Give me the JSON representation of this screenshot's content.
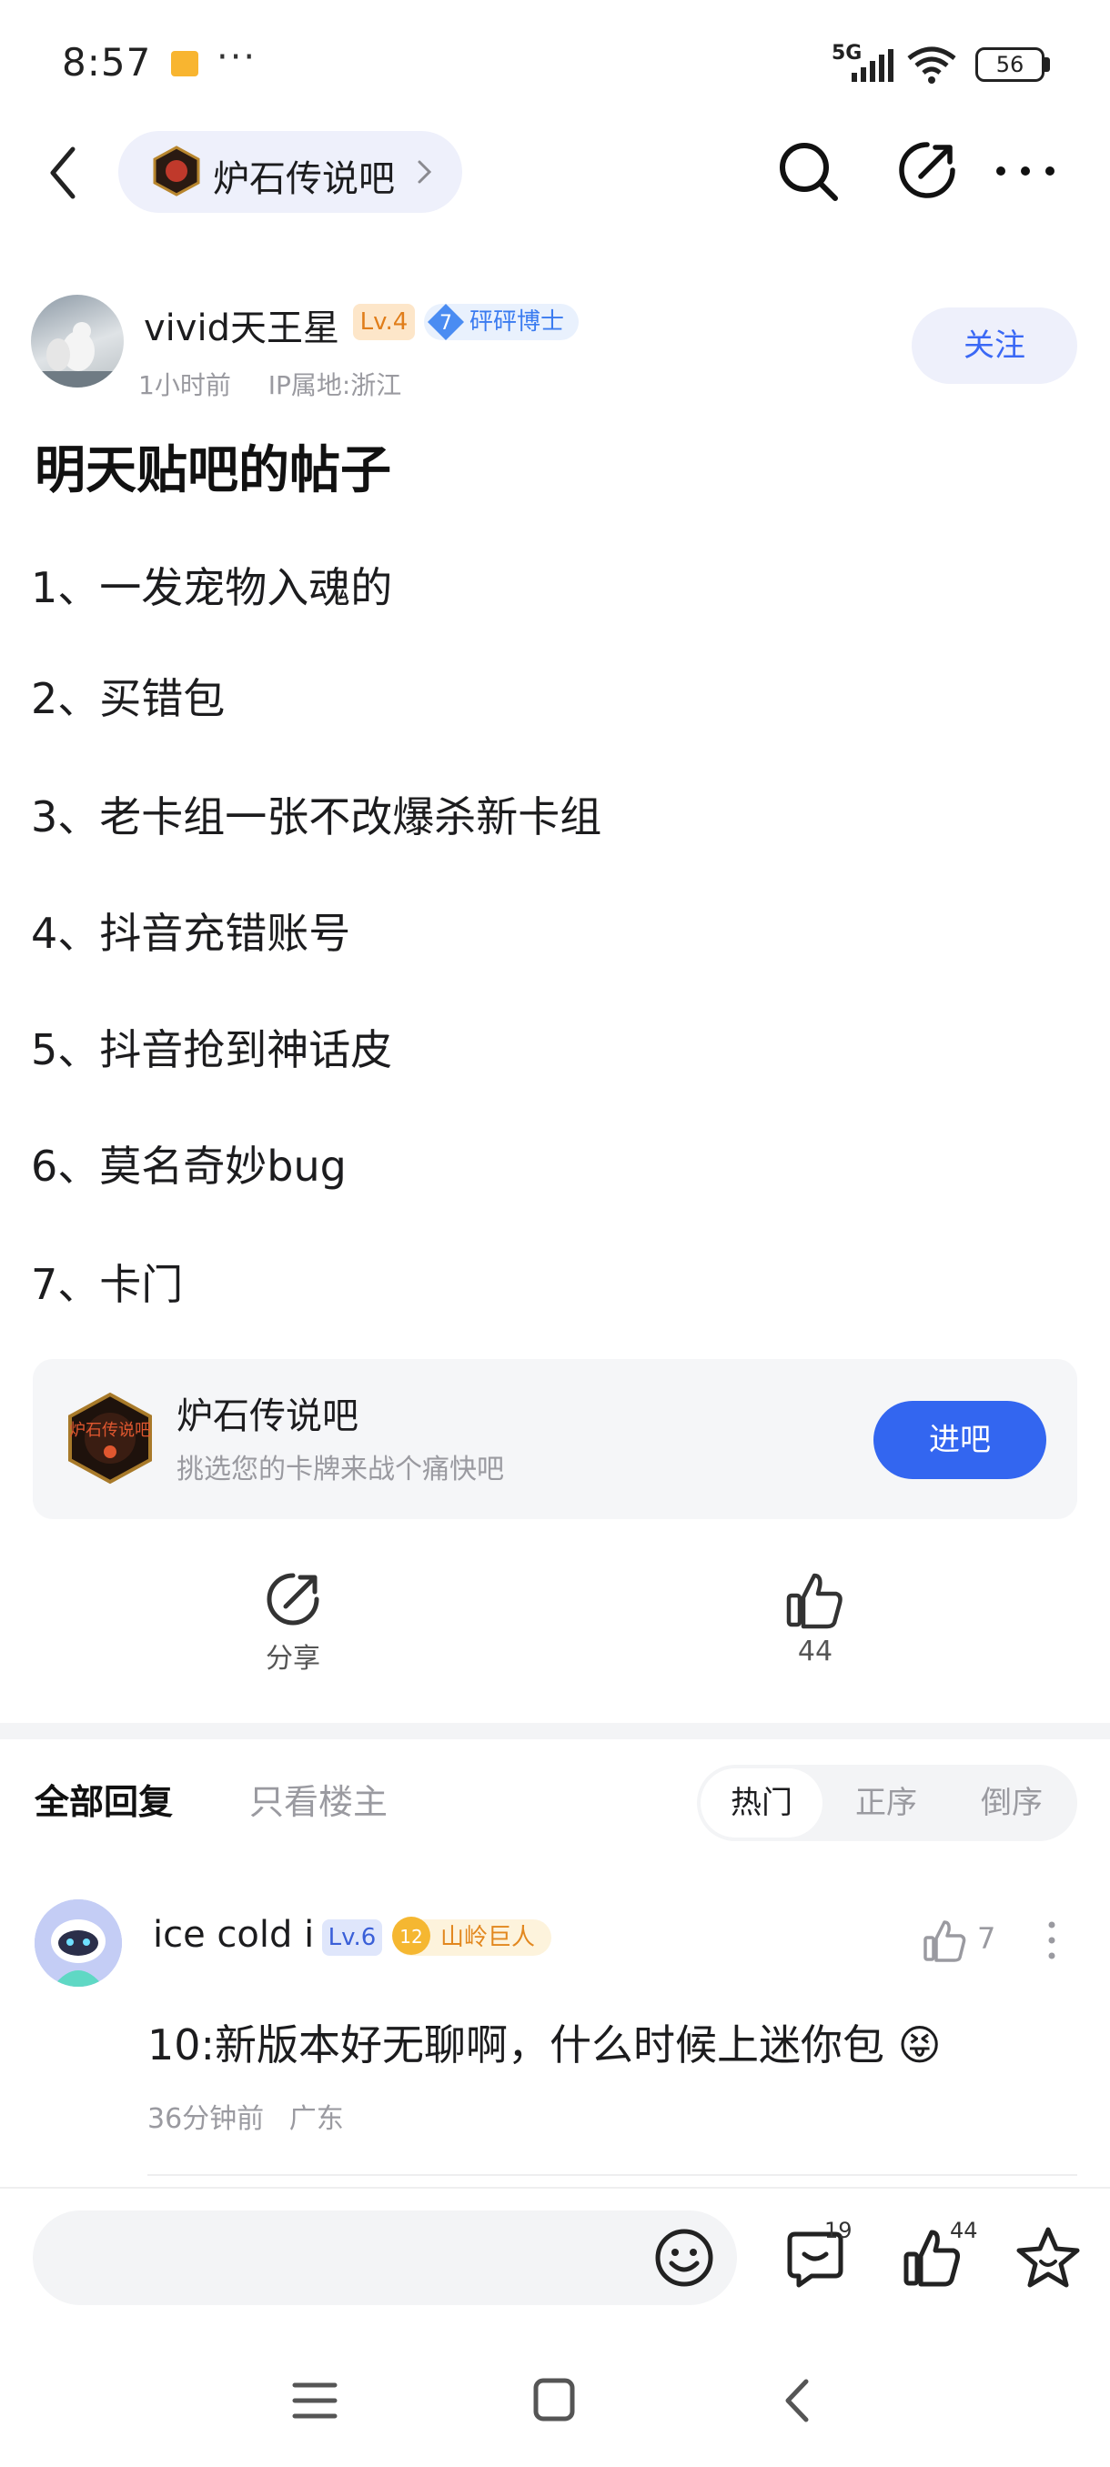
{
  "status_bar": {
    "time": "8:57",
    "more": "···",
    "network": "5G",
    "battery": "56"
  },
  "nav": {
    "forum_name": "炉石传说吧",
    "forum_logo_text": "炉石传说吧",
    "icons": [
      "back-icon",
      "chevron-right-icon",
      "search-icon",
      "compose-icon",
      "more-icon"
    ]
  },
  "author": {
    "name": "vivid天王星",
    "level": "Lv.4",
    "title_level": "7",
    "title": "砰砰博士",
    "time": "1小时前",
    "ip_location": "IP属地:浙江",
    "follow_label": "关注"
  },
  "post": {
    "title": "明天贴吧的帖子",
    "lines": [
      "1、一发宠物入魂的",
      "2、买错包",
      "3、老卡组一张不改爆杀新卡组",
      "4、抖音充错账号",
      "5、抖音抢到神话皮",
      "6、莫名奇妙bug",
      "7、卡门"
    ]
  },
  "forum_card": {
    "name": "炉石传说吧",
    "description": "挑选您的卡牌来战个痛快吧",
    "enter_label": "进吧"
  },
  "actions": {
    "share_label": "分享",
    "like_count": "44"
  },
  "replies": {
    "tab_all": "全部回复",
    "tab_op_only": "只看楼主",
    "sort_options": [
      "热门",
      "正序",
      "倒序"
    ],
    "selected_sort": "热门"
  },
  "comment": {
    "user": "ice cold i",
    "level": "Lv.6",
    "title_level": "12",
    "title": "山岭巨人",
    "likes": "7",
    "text": "10:新版本好无聊啊，什么时候上迷你包",
    "emoji": "😝",
    "time": "36分钟前",
    "location": "广东"
  },
  "bottom_bar": {
    "reply_placeholder": "",
    "comment_count": "19",
    "like_count": "44"
  },
  "colors": {
    "accent": "#3366f0",
    "pill_bg": "#eef0fb",
    "muted_text": "#9a9aa0",
    "level4": "#e07d1a",
    "level6": "#3a5fd8",
    "badge_blue": "#3a7bf0",
    "badge_gold": "#e2871e"
  }
}
